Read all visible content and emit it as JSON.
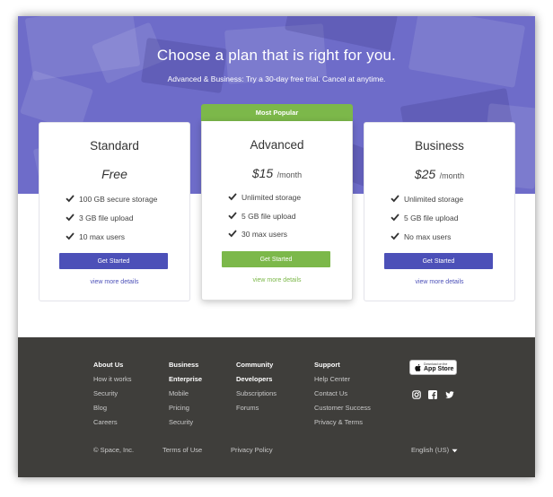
{
  "hero": {
    "title": "Choose a plan that is right for you.",
    "subtitle": "Advanced & Business: Try a 30-day free trial. Cancel at anytime.",
    "background_color": "#6e6cc9"
  },
  "plans": [
    {
      "name": "Standard",
      "price": "Free",
      "period": "",
      "features": [
        "100 GB secure storage",
        "3 GB file upload",
        "10 max users"
      ],
      "button_label": "Get Started",
      "more_label": "view more details",
      "accent": "#4c50b8"
    },
    {
      "name": "Advanced",
      "badge": "Most Popular",
      "price": "$15",
      "period": "/month",
      "features": [
        "Unlimited storage",
        "5 GB file upload",
        "30 max users"
      ],
      "button_label": "Get Started",
      "more_label": "view more details",
      "accent": "#7cb84a"
    },
    {
      "name": "Business",
      "price": "$25",
      "period": "/month",
      "features": [
        "Unlimited storage",
        "5 GB file upload",
        "No max users"
      ],
      "button_label": "Get Started",
      "more_label": "view more details",
      "accent": "#4c50b8"
    }
  ],
  "footer": {
    "columns": [
      {
        "heading": "About Us",
        "links": [
          "How it works",
          "Security",
          "Blog",
          "Careers"
        ]
      },
      {
        "heading": "Business",
        "links": [
          "Enterprise",
          "Mobile",
          "Pricing",
          "Security"
        ]
      },
      {
        "heading": "Community",
        "links": [
          "Developers",
          "Subscriptions",
          "Forums"
        ]
      },
      {
        "heading": "Support",
        "links": [
          "Help Center",
          "Contact Us",
          "Customer Success",
          "Privacy & Terms"
        ]
      }
    ],
    "app_store": {
      "small": "Download on the",
      "big": "App Store"
    },
    "social_icons": [
      "instagram-icon",
      "facebook-icon",
      "twitter-icon"
    ],
    "copyright": "© Space, Inc.",
    "terms": "Terms of Use",
    "privacy": "Privacy Policy",
    "language": "English (US)",
    "background_color": "#3f3e3b"
  }
}
